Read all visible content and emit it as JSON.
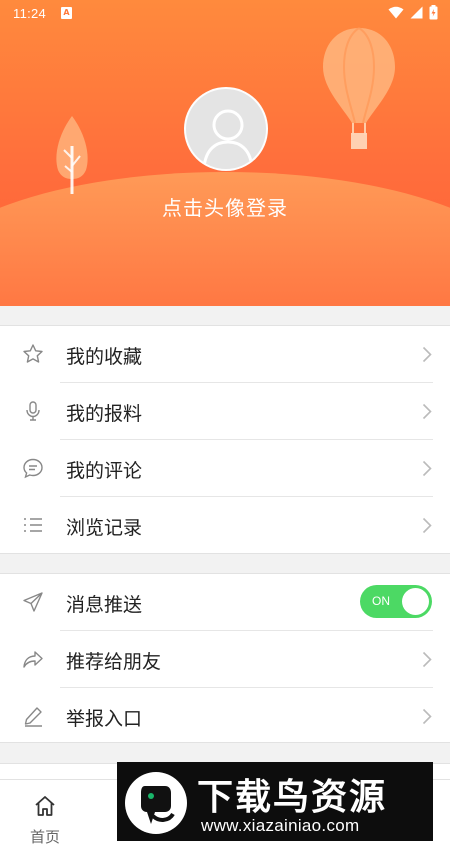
{
  "status_bar": {
    "time": "11:24",
    "notification_glyph": "A"
  },
  "header": {
    "login_prompt": "点击头像登录"
  },
  "menu_group_1": [
    {
      "label": "我的收藏",
      "icon": "star-icon"
    },
    {
      "label": "我的报料",
      "icon": "microphone-icon"
    },
    {
      "label": "我的评论",
      "icon": "comment-icon"
    },
    {
      "label": "浏览记录",
      "icon": "list-icon"
    }
  ],
  "menu_group_2": [
    {
      "label": "消息推送",
      "icon": "send-icon",
      "toggle": "ON"
    },
    {
      "label": "推荐给朋友",
      "icon": "share-icon"
    },
    {
      "label": "举报入口",
      "icon": "pencil-icon"
    }
  ],
  "tabbar": {
    "tabs": [
      {
        "label": "首页",
        "icon": "home-icon"
      },
      {
        "label": "",
        "icon": ""
      },
      {
        "label": "",
        "icon": ""
      },
      {
        "label": "",
        "icon": ""
      },
      {
        "label": "",
        "icon": ""
      }
    ]
  },
  "watermark": {
    "title": "下载鸟资源",
    "url": "www.xiazainiao.com"
  },
  "colors": {
    "accent": "#ff6a3c",
    "toggle_on": "#4cd964",
    "divider": "#e6e6e6"
  }
}
